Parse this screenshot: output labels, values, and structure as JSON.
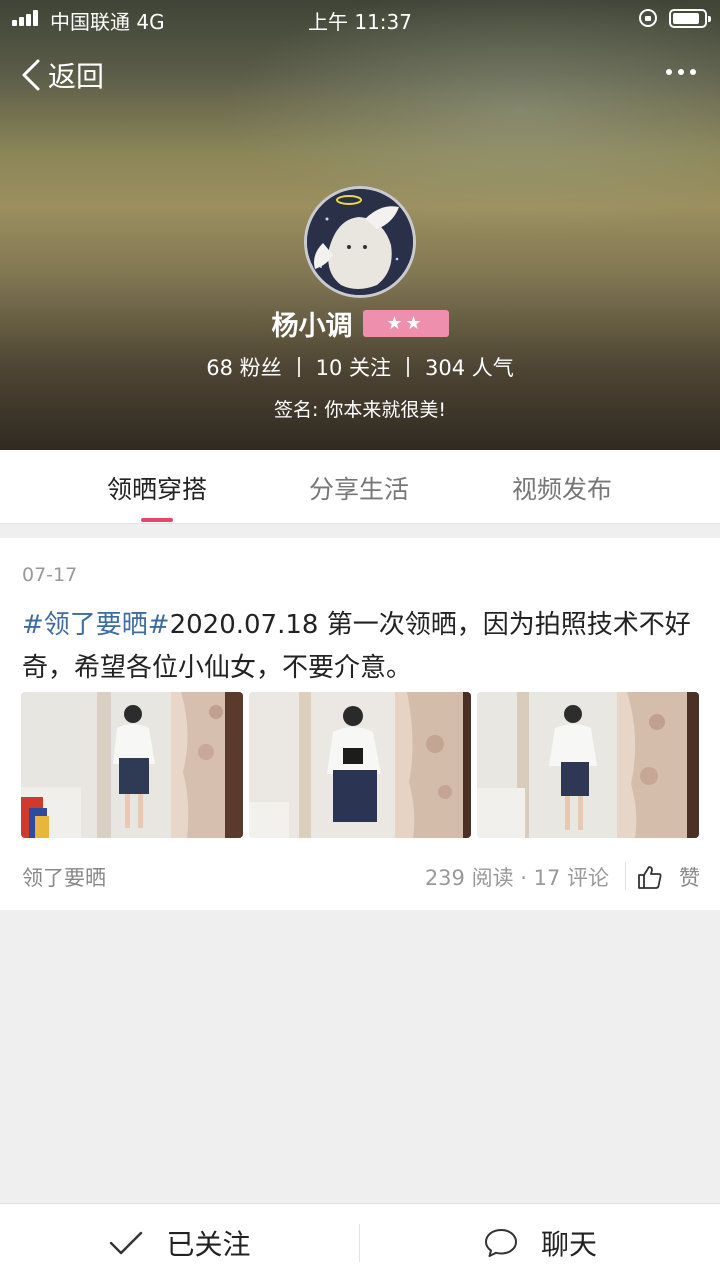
{
  "status_bar": {
    "carrier": "中国联通  4G",
    "time": "上午 11:37",
    "icons": [
      "signal-icon",
      "rotation-lock-icon",
      "battery-icon"
    ]
  },
  "nav": {
    "back_label": "返回",
    "back_icon": "chevron-left-icon",
    "more_icon": "more-dots-icon"
  },
  "profile": {
    "name": "杨小调",
    "level_badge": "★★",
    "stats": {
      "fans": "68 粉丝",
      "following": "10 关注",
      "popularity": "304 人气"
    },
    "signature": "签名: 你本来就很美!"
  },
  "tabs": [
    {
      "label": "领晒穿搭",
      "active": true
    },
    {
      "label": "分享生活",
      "active": false
    },
    {
      "label": "视频发布",
      "active": false
    }
  ],
  "post": {
    "date": "07-17",
    "hashtag": "#领了要晒#",
    "text": "2020.07.18 第一次领晒，因为拍照技术不好奇，希望各位小仙女，不要介意。",
    "photo_count": 3,
    "tag": "领了要晒",
    "meta": "239 阅读 · 17 评论",
    "like_label": "赞",
    "like_icon": "thumbs-up-icon"
  },
  "bottom_bar": {
    "follow_label": "已关注",
    "follow_icon": "checkmark-icon",
    "chat_label": "聊天",
    "chat_icon": "chat-bubble-icon"
  },
  "colors": {
    "accent": "#e6486a",
    "hashtag": "#3d6c9e",
    "badge": "#ef8fae"
  }
}
